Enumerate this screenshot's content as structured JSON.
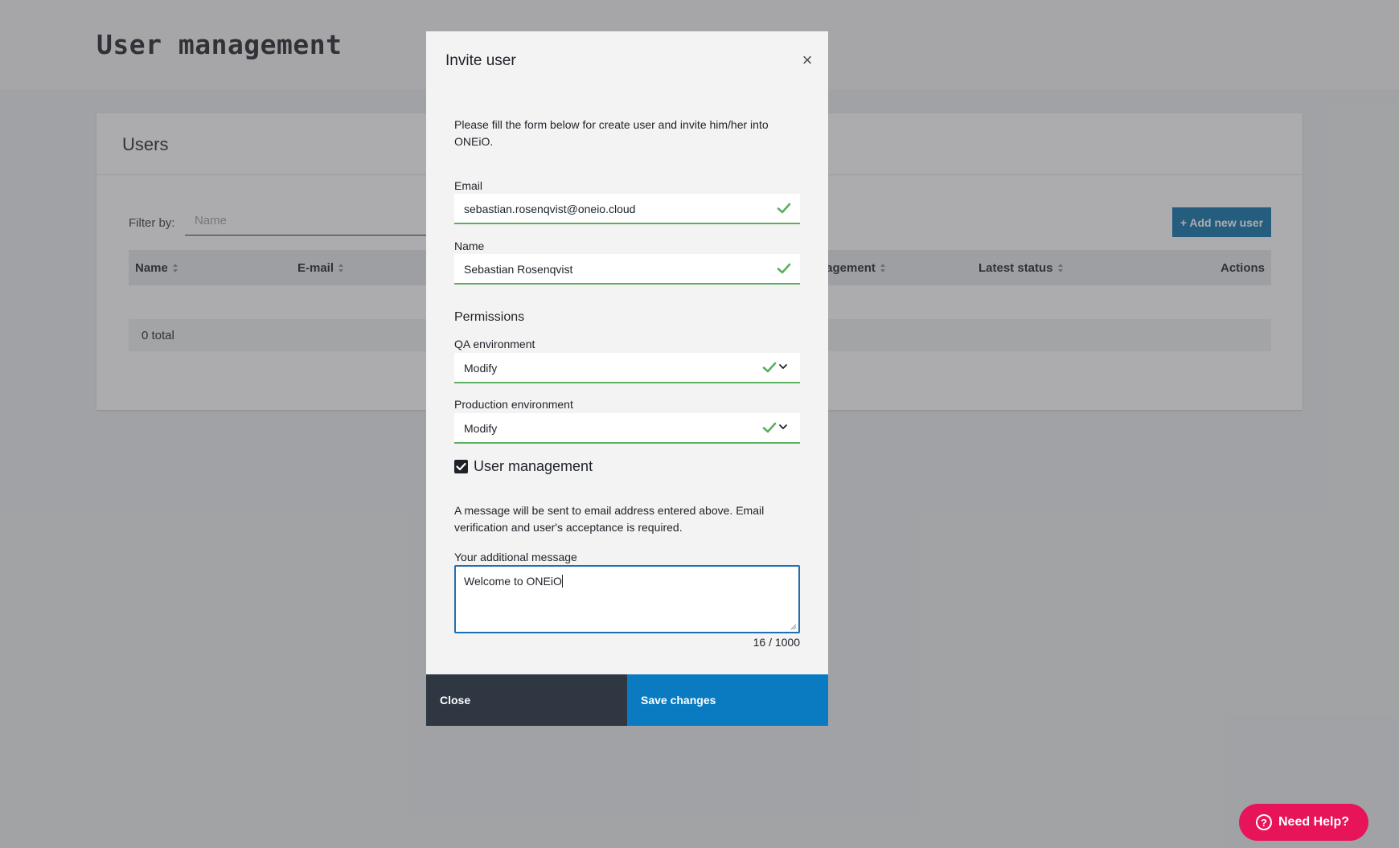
{
  "page": {
    "title": "User management"
  },
  "users_card": {
    "title": "Users",
    "filter_label": "Filter by:",
    "filter_placeholder": "Name",
    "add_button": "+ Add new user",
    "columns": [
      "Name",
      "E-mail",
      "nagement",
      "Latest status",
      "Actions"
    ],
    "total": "0 total"
  },
  "modal": {
    "title": "Invite user",
    "close_icon": "close-icon",
    "intro": "Please fill the form below for create user and invite him/her into ONEiO.",
    "email_label": "Email",
    "email_value": "sebastian.rosenqvist@oneio.cloud",
    "name_label": "Name",
    "name_value": "Sebastian Rosenqvist",
    "permissions_title": "Permissions",
    "qa_label": "QA environment",
    "qa_value": "Modify",
    "prod_label": "Production environment",
    "prod_value": "Modify",
    "user_management_label": "User management",
    "user_management_checked": true,
    "notice": "A message will be sent to email address entered above. Email verification and user's acceptance is required.",
    "message_label": "Your additional message",
    "message_value": "Welcome to ONEiO",
    "counter": "16 / 1000",
    "close_button": "Close",
    "save_button": "Save changes"
  },
  "help": {
    "label": "Need Help?",
    "icon": "question-circle-icon"
  },
  "colors": {
    "accent_blue": "#0a7bc0",
    "valid_green": "#5cae61",
    "help_pink": "#e8145a",
    "dark_button": "#2e3742"
  }
}
